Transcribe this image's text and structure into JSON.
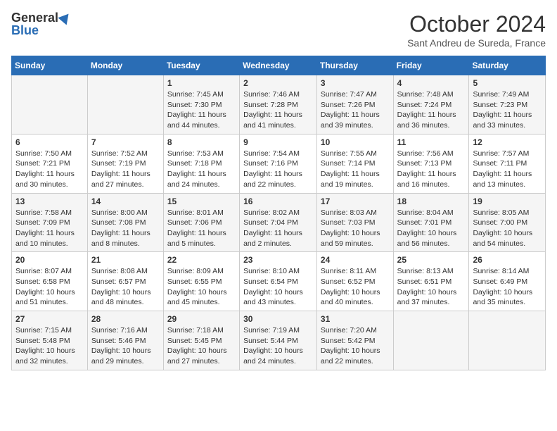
{
  "logo": {
    "general": "General",
    "blue": "Blue"
  },
  "header": {
    "month": "October 2024",
    "location": "Sant Andreu de Sureda, France"
  },
  "days_of_week": [
    "Sunday",
    "Monday",
    "Tuesday",
    "Wednesday",
    "Thursday",
    "Friday",
    "Saturday"
  ],
  "weeks": [
    [
      {
        "day": "",
        "content": ""
      },
      {
        "day": "",
        "content": ""
      },
      {
        "day": "1",
        "content": "Sunrise: 7:45 AM\nSunset: 7:30 PM\nDaylight: 11 hours and 44 minutes."
      },
      {
        "day": "2",
        "content": "Sunrise: 7:46 AM\nSunset: 7:28 PM\nDaylight: 11 hours and 41 minutes."
      },
      {
        "day": "3",
        "content": "Sunrise: 7:47 AM\nSunset: 7:26 PM\nDaylight: 11 hours and 39 minutes."
      },
      {
        "day": "4",
        "content": "Sunrise: 7:48 AM\nSunset: 7:24 PM\nDaylight: 11 hours and 36 minutes."
      },
      {
        "day": "5",
        "content": "Sunrise: 7:49 AM\nSunset: 7:23 PM\nDaylight: 11 hours and 33 minutes."
      }
    ],
    [
      {
        "day": "6",
        "content": "Sunrise: 7:50 AM\nSunset: 7:21 PM\nDaylight: 11 hours and 30 minutes."
      },
      {
        "day": "7",
        "content": "Sunrise: 7:52 AM\nSunset: 7:19 PM\nDaylight: 11 hours and 27 minutes."
      },
      {
        "day": "8",
        "content": "Sunrise: 7:53 AM\nSunset: 7:18 PM\nDaylight: 11 hours and 24 minutes."
      },
      {
        "day": "9",
        "content": "Sunrise: 7:54 AM\nSunset: 7:16 PM\nDaylight: 11 hours and 22 minutes."
      },
      {
        "day": "10",
        "content": "Sunrise: 7:55 AM\nSunset: 7:14 PM\nDaylight: 11 hours and 19 minutes."
      },
      {
        "day": "11",
        "content": "Sunrise: 7:56 AM\nSunset: 7:13 PM\nDaylight: 11 hours and 16 minutes."
      },
      {
        "day": "12",
        "content": "Sunrise: 7:57 AM\nSunset: 7:11 PM\nDaylight: 11 hours and 13 minutes."
      }
    ],
    [
      {
        "day": "13",
        "content": "Sunrise: 7:58 AM\nSunset: 7:09 PM\nDaylight: 11 hours and 10 minutes."
      },
      {
        "day": "14",
        "content": "Sunrise: 8:00 AM\nSunset: 7:08 PM\nDaylight: 11 hours and 8 minutes."
      },
      {
        "day": "15",
        "content": "Sunrise: 8:01 AM\nSunset: 7:06 PM\nDaylight: 11 hours and 5 minutes."
      },
      {
        "day": "16",
        "content": "Sunrise: 8:02 AM\nSunset: 7:04 PM\nDaylight: 11 hours and 2 minutes."
      },
      {
        "day": "17",
        "content": "Sunrise: 8:03 AM\nSunset: 7:03 PM\nDaylight: 10 hours and 59 minutes."
      },
      {
        "day": "18",
        "content": "Sunrise: 8:04 AM\nSunset: 7:01 PM\nDaylight: 10 hours and 56 minutes."
      },
      {
        "day": "19",
        "content": "Sunrise: 8:05 AM\nSunset: 7:00 PM\nDaylight: 10 hours and 54 minutes."
      }
    ],
    [
      {
        "day": "20",
        "content": "Sunrise: 8:07 AM\nSunset: 6:58 PM\nDaylight: 10 hours and 51 minutes."
      },
      {
        "day": "21",
        "content": "Sunrise: 8:08 AM\nSunset: 6:57 PM\nDaylight: 10 hours and 48 minutes."
      },
      {
        "day": "22",
        "content": "Sunrise: 8:09 AM\nSunset: 6:55 PM\nDaylight: 10 hours and 45 minutes."
      },
      {
        "day": "23",
        "content": "Sunrise: 8:10 AM\nSunset: 6:54 PM\nDaylight: 10 hours and 43 minutes."
      },
      {
        "day": "24",
        "content": "Sunrise: 8:11 AM\nSunset: 6:52 PM\nDaylight: 10 hours and 40 minutes."
      },
      {
        "day": "25",
        "content": "Sunrise: 8:13 AM\nSunset: 6:51 PM\nDaylight: 10 hours and 37 minutes."
      },
      {
        "day": "26",
        "content": "Sunrise: 8:14 AM\nSunset: 6:49 PM\nDaylight: 10 hours and 35 minutes."
      }
    ],
    [
      {
        "day": "27",
        "content": "Sunrise: 7:15 AM\nSunset: 5:48 PM\nDaylight: 10 hours and 32 minutes."
      },
      {
        "day": "28",
        "content": "Sunrise: 7:16 AM\nSunset: 5:46 PM\nDaylight: 10 hours and 29 minutes."
      },
      {
        "day": "29",
        "content": "Sunrise: 7:18 AM\nSunset: 5:45 PM\nDaylight: 10 hours and 27 minutes."
      },
      {
        "day": "30",
        "content": "Sunrise: 7:19 AM\nSunset: 5:44 PM\nDaylight: 10 hours and 24 minutes."
      },
      {
        "day": "31",
        "content": "Sunrise: 7:20 AM\nSunset: 5:42 PM\nDaylight: 10 hours and 22 minutes."
      },
      {
        "day": "",
        "content": ""
      },
      {
        "day": "",
        "content": ""
      }
    ]
  ]
}
